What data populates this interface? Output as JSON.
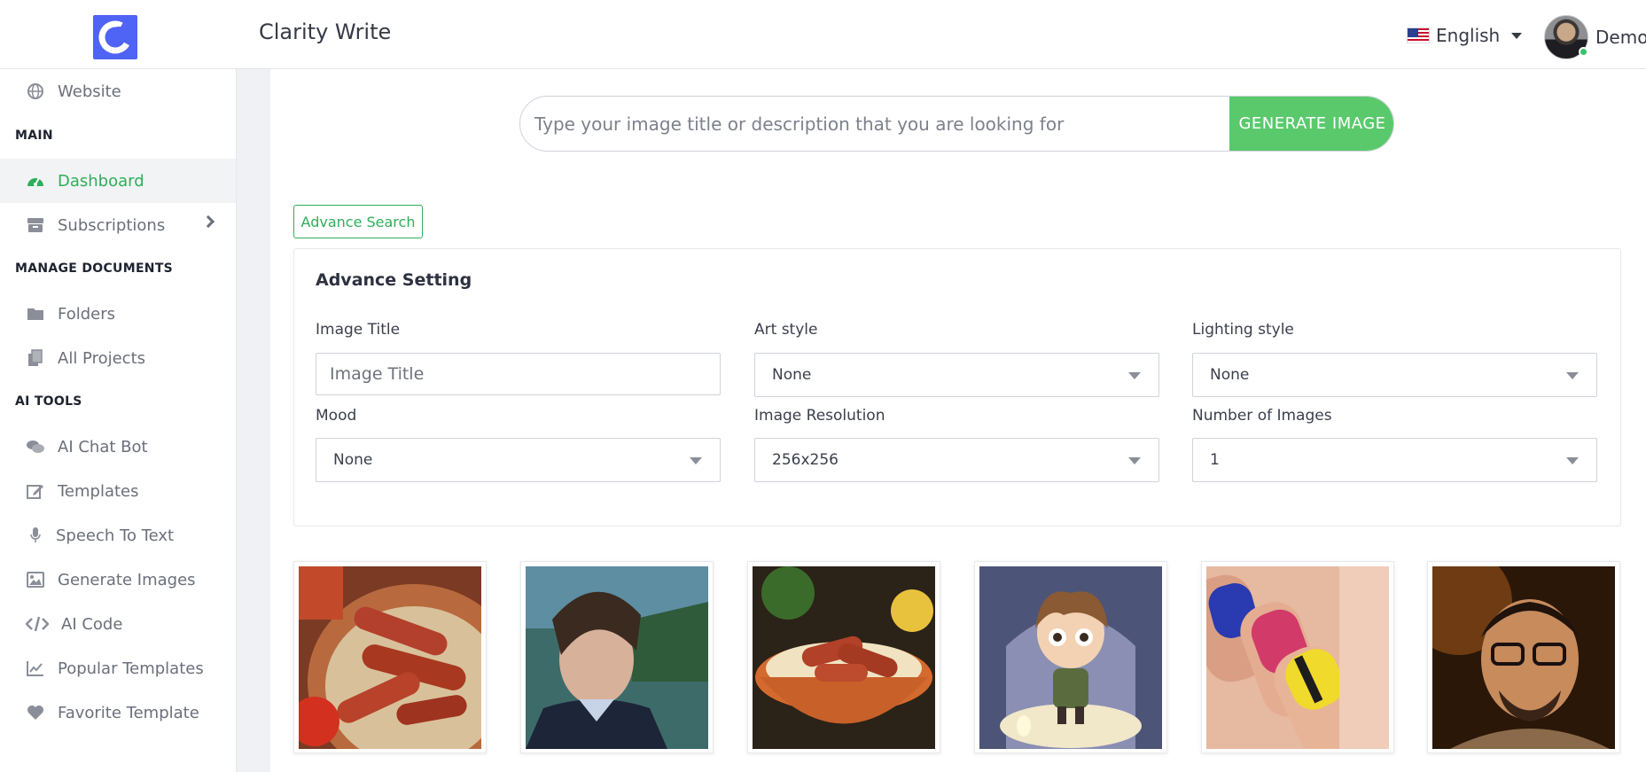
{
  "header": {
    "app_title": "Clarity Write",
    "language": "English",
    "user_name": "Demo"
  },
  "sidebar": {
    "website": "Website",
    "sections": {
      "main": "MAIN",
      "manage_documents": "MANAGE DOCUMENTS",
      "ai_tools": "AI TOOLS"
    },
    "items": {
      "dashboard": "Dashboard",
      "subscriptions": "Subscriptions",
      "folders": "Folders",
      "all_projects": "All Projects",
      "ai_chat_bot": "AI Chat Bot",
      "templates": "Templates",
      "speech_to_text": "Speech To Text",
      "generate_images": "Generate Images",
      "ai_code": "AI Code",
      "popular_templates": "Popular Templates",
      "favorite_template": "Favorite Template"
    },
    "active_item": "Dashboard"
  },
  "search": {
    "placeholder": "Type your image title or description that you are looking for",
    "value": "",
    "button": "GENERATE IMAGE"
  },
  "advance_search_button": "Advance Search",
  "advance_setting": {
    "title": "Advance Setting",
    "image_title": {
      "label": "Image Title",
      "placeholder": "Image Title",
      "value": ""
    },
    "art_style": {
      "label": "Art style",
      "value": "None"
    },
    "lighting_style": {
      "label": "Lighting style",
      "value": "None"
    },
    "mood": {
      "label": "Mood",
      "value": "None"
    },
    "image_resolution": {
      "label": "Image Resolution",
      "value": "256x256"
    },
    "number_of_images": {
      "label": "Number of Images",
      "value": "1"
    }
  },
  "gallery": [
    "sausages-bowl-image",
    "man-portrait-image",
    "sausage-rice-bowl-image",
    "cartoon-boy-image",
    "painted-nails-image",
    "man-glasses-portrait-image"
  ],
  "colors": {
    "accent_green": "#5ac96c",
    "active_green": "#2fae5b",
    "logo_blue": "#4f63f5"
  }
}
